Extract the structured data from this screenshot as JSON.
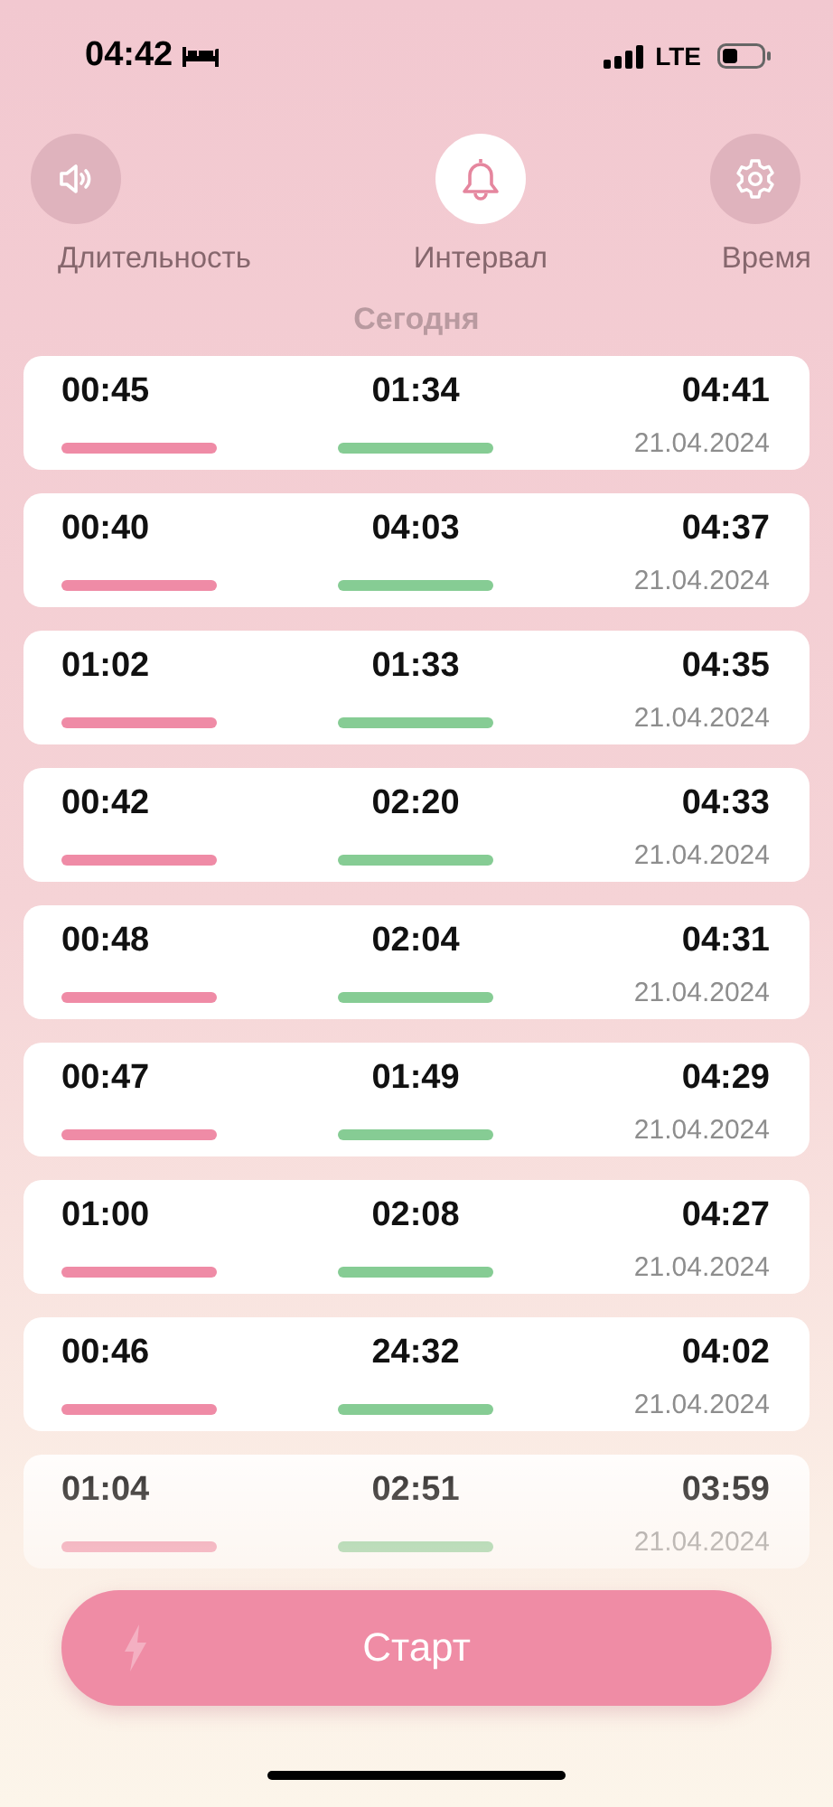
{
  "status_bar": {
    "time": "04:42",
    "network": "LTE"
  },
  "tabs": [
    {
      "kind": "sound",
      "label": "Длительность",
      "selected": false
    },
    {
      "kind": "bell",
      "label": "Интервал",
      "selected": true
    },
    {
      "kind": "gear",
      "label": "Время",
      "selected": false
    }
  ],
  "section_title": "Сегодня",
  "entries": [
    {
      "duration": "00:45",
      "interval": "01:34",
      "time": "04:41",
      "date": "21.04.2024"
    },
    {
      "duration": "00:40",
      "interval": "04:03",
      "time": "04:37",
      "date": "21.04.2024"
    },
    {
      "duration": "01:02",
      "interval": "01:33",
      "time": "04:35",
      "date": "21.04.2024"
    },
    {
      "duration": "00:42",
      "interval": "02:20",
      "time": "04:33",
      "date": "21.04.2024"
    },
    {
      "duration": "00:48",
      "interval": "02:04",
      "time": "04:31",
      "date": "21.04.2024"
    },
    {
      "duration": "00:47",
      "interval": "01:49",
      "time": "04:29",
      "date": "21.04.2024"
    },
    {
      "duration": "01:00",
      "interval": "02:08",
      "time": "04:27",
      "date": "21.04.2024"
    },
    {
      "duration": "00:46",
      "interval": "24:32",
      "time": "04:02",
      "date": "21.04.2024"
    },
    {
      "duration": "01:04",
      "interval": "02:51",
      "time": "03:59",
      "date": "21.04.2024"
    }
  ],
  "start_button": {
    "label": "Старт"
  }
}
